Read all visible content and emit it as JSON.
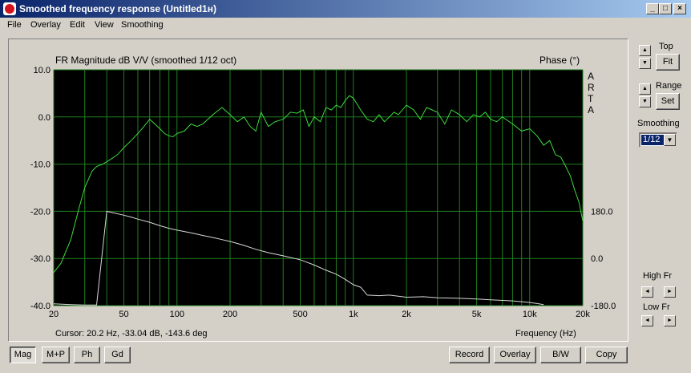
{
  "window": {
    "title": "Smoothed frequency response (Untitled1н)",
    "minimize": "_",
    "maximize": "□",
    "close": "×"
  },
  "menu": [
    "File",
    "Overlay",
    "Edit",
    "View",
    "Smoothing"
  ],
  "chart": {
    "title": "FR Magnitude dB V/V (smoothed 1/12 oct)",
    "phase_label": "Phase (°)",
    "brand_letters": [
      "A",
      "R",
      "T",
      "A"
    ],
    "x_label": "Frequency (Hz)",
    "cursor_readout": "Cursor: 20.2 Hz, -33.04 dB, -143.6 deg",
    "y_ticks": [
      "10.0",
      "0.0",
      "-10.0",
      "-20.0",
      "-30.0",
      "-40.0"
    ],
    "x_ticks": [
      "20",
      "50",
      "100",
      "200",
      "500",
      "1k",
      "2k",
      "5k",
      "10k",
      "20k"
    ],
    "phase_ticks": [
      "180.0",
      "0.0",
      "-180.0"
    ],
    "colors": {
      "background": "#000000",
      "grid": "#1f7d1f",
      "magnitude": "#3ddc3d",
      "phase": "#d8d8d8",
      "axis_text": "#000000"
    }
  },
  "chart_data": {
    "type": "line",
    "title": "FR Magnitude dB V/V (smoothed 1/12 oct)",
    "xlabel": "Frequency (Hz)",
    "ylabel": "",
    "y2label": "Phase (°)",
    "x_scale": "log",
    "xlim": [
      20,
      20000
    ],
    "ylim": [
      -40,
      10
    ],
    "y2lim": [
      -180,
      180
    ],
    "grid": true,
    "series": [
      {
        "axis": "left",
        "x": [
          20,
          22,
          25,
          28,
          30,
          33,
          35,
          38,
          42,
          46,
          50,
          55,
          60,
          65,
          70,
          75,
          80,
          85,
          90,
          95,
          100,
          110,
          120,
          130,
          140,
          160,
          180,
          200,
          220,
          240,
          260,
          280,
          300,
          330,
          360,
          400,
          440,
          480,
          520,
          560,
          600,
          650,
          700,
          750,
          800,
          850,
          900,
          950,
          1000,
          1100,
          1200,
          1300,
          1400,
          1500,
          1600,
          1700,
          1800,
          2000,
          2200,
          2400,
          2600,
          2800,
          3000,
          3300,
          3600,
          4000,
          4400,
          4800,
          5200,
          5600,
          6000,
          6500,
          7000,
          8000,
          9000,
          10000,
          11000,
          12000,
          13000,
          14000,
          15000,
          16000,
          17000,
          18000,
          19000,
          20000
        ],
        "values": [
          -33.0,
          -31.0,
          -26.0,
          -19.0,
          -15.0,
          -11.5,
          -10.5,
          -10.0,
          -9.0,
          -8.0,
          -6.5,
          -5.0,
          -3.5,
          -2.0,
          -0.5,
          -1.5,
          -2.5,
          -3.5,
          -4.0,
          -4.2,
          -3.5,
          -3.0,
          -1.5,
          -2.0,
          -1.5,
          0.5,
          2.0,
          0.5,
          -1.0,
          0.0,
          -2.0,
          -3.0,
          1.0,
          -2.0,
          -1.0,
          -0.5,
          1.0,
          0.8,
          1.5,
          -2.0,
          0.0,
          -1.0,
          2.0,
          1.5,
          2.5,
          2.0,
          3.5,
          4.5,
          4.0,
          1.5,
          -0.5,
          -1.0,
          0.5,
          -1.0,
          0.0,
          1.0,
          0.5,
          2.5,
          1.5,
          -0.5,
          2.0,
          1.5,
          1.0,
          -1.5,
          1.5,
          0.5,
          -1.0,
          0.5,
          0.0,
          1.0,
          -0.5,
          -1.0,
          0.0,
          -1.5,
          -3.0,
          -2.5,
          -4.0,
          -6.0,
          -5.0,
          -8.0,
          -8.5,
          -10.5,
          -12.5,
          -15.5,
          -18.0,
          -22.0
        ],
        "name": ""
      },
      {
        "axis": "right",
        "x": [
          20,
          25,
          30,
          35,
          40,
          45,
          50,
          55,
          60,
          70,
          80,
          90,
          100,
          120,
          140,
          160,
          180,
          200,
          240,
          280,
          330,
          400,
          500,
          600,
          700,
          800,
          900,
          1000,
          1100,
          1200,
          1400,
          1600,
          2000,
          2500,
          3000,
          4000,
          5000,
          6000,
          7000,
          8000,
          9000,
          10000,
          11000,
          12000
        ],
        "values": [
          -173,
          -176,
          -178,
          -178,
          180,
          172,
          165,
          158,
          150,
          138,
          125,
          115,
          108,
          98,
          88,
          80,
          72,
          65,
          50,
          35,
          22,
          10,
          -5,
          -25,
          -45,
          -60,
          -80,
          -100,
          -110,
          -140,
          -142,
          -140,
          -148,
          -146,
          -150,
          -152,
          -155,
          -158,
          -160,
          -162,
          -165,
          -168,
          -172,
          -176
        ],
        "name": ""
      }
    ]
  },
  "bottom_buttons": {
    "mag": "Mag",
    "mp": "M+P",
    "ph": "Ph",
    "gd": "Gd",
    "record": "Record",
    "overlay": "Overlay",
    "bw": "B/W",
    "copy": "Copy"
  },
  "side": {
    "top_label": "Top",
    "fit_label": "Fit",
    "range_label": "Range",
    "set_label": "Set",
    "smoothing_label": "Smoothing",
    "smoothing_value": "1/12",
    "high_fr_label": "High Fr",
    "low_fr_label": "Low Fr"
  }
}
